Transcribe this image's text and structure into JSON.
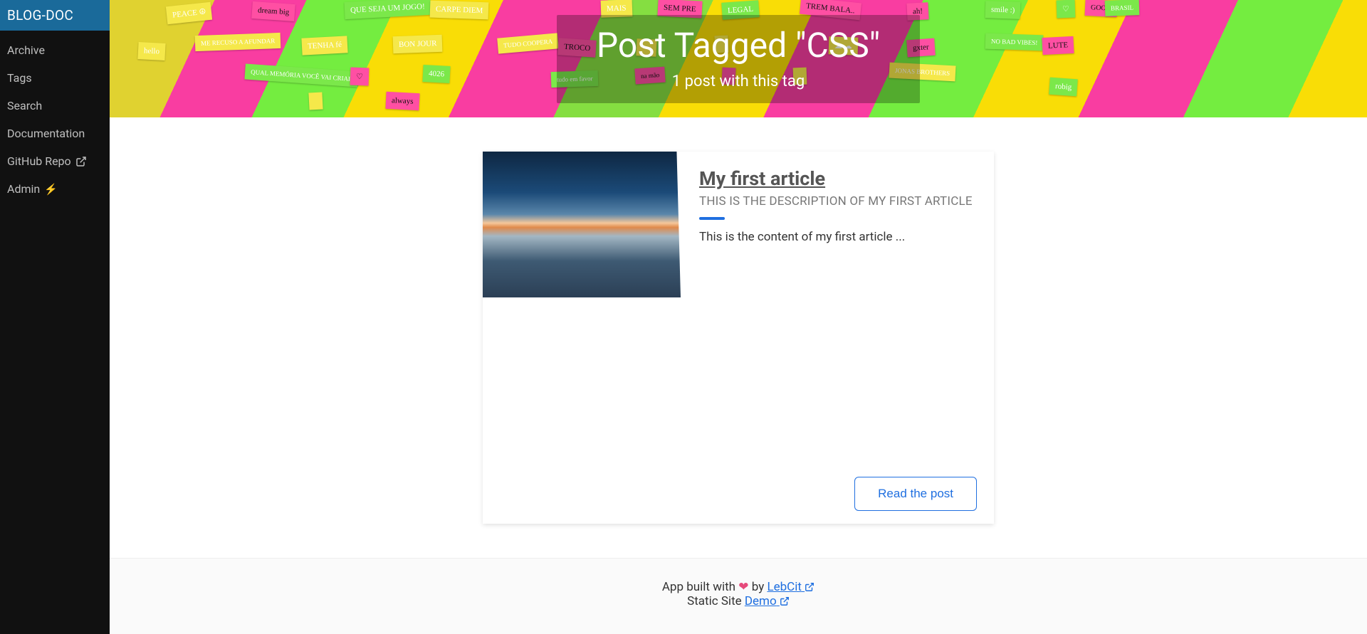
{
  "sidebar": {
    "brand": "BLOG-DOC",
    "items": [
      {
        "label": "Archive",
        "external": false,
        "icon": null
      },
      {
        "label": "Tags",
        "external": false,
        "icon": null
      },
      {
        "label": "Search",
        "external": false,
        "icon": null
      },
      {
        "label": "Documentation",
        "external": false,
        "icon": null
      },
      {
        "label": "GitHub Repo",
        "external": true,
        "icon": "external-link-icon"
      },
      {
        "label": "Admin",
        "external": false,
        "icon": "bolt-icon"
      }
    ]
  },
  "hero": {
    "title": "Post Tagged \"CSS\"",
    "subtitle": "1 post with this tag"
  },
  "posts": [
    {
      "title": "My first article",
      "description": "THIS IS THE DESCRIPTION OF MY FIRST ARTICLE",
      "excerpt": "This is the content of my first article ...",
      "read_label": "Read the post"
    }
  ],
  "footer": {
    "line1_pre": "App built with ",
    "line1_mid": " by ",
    "author": "LebCit",
    "line2_pre": "Static Site ",
    "demo": "Demo"
  },
  "icons": {
    "heart": "❤",
    "bolt": "⚡"
  }
}
